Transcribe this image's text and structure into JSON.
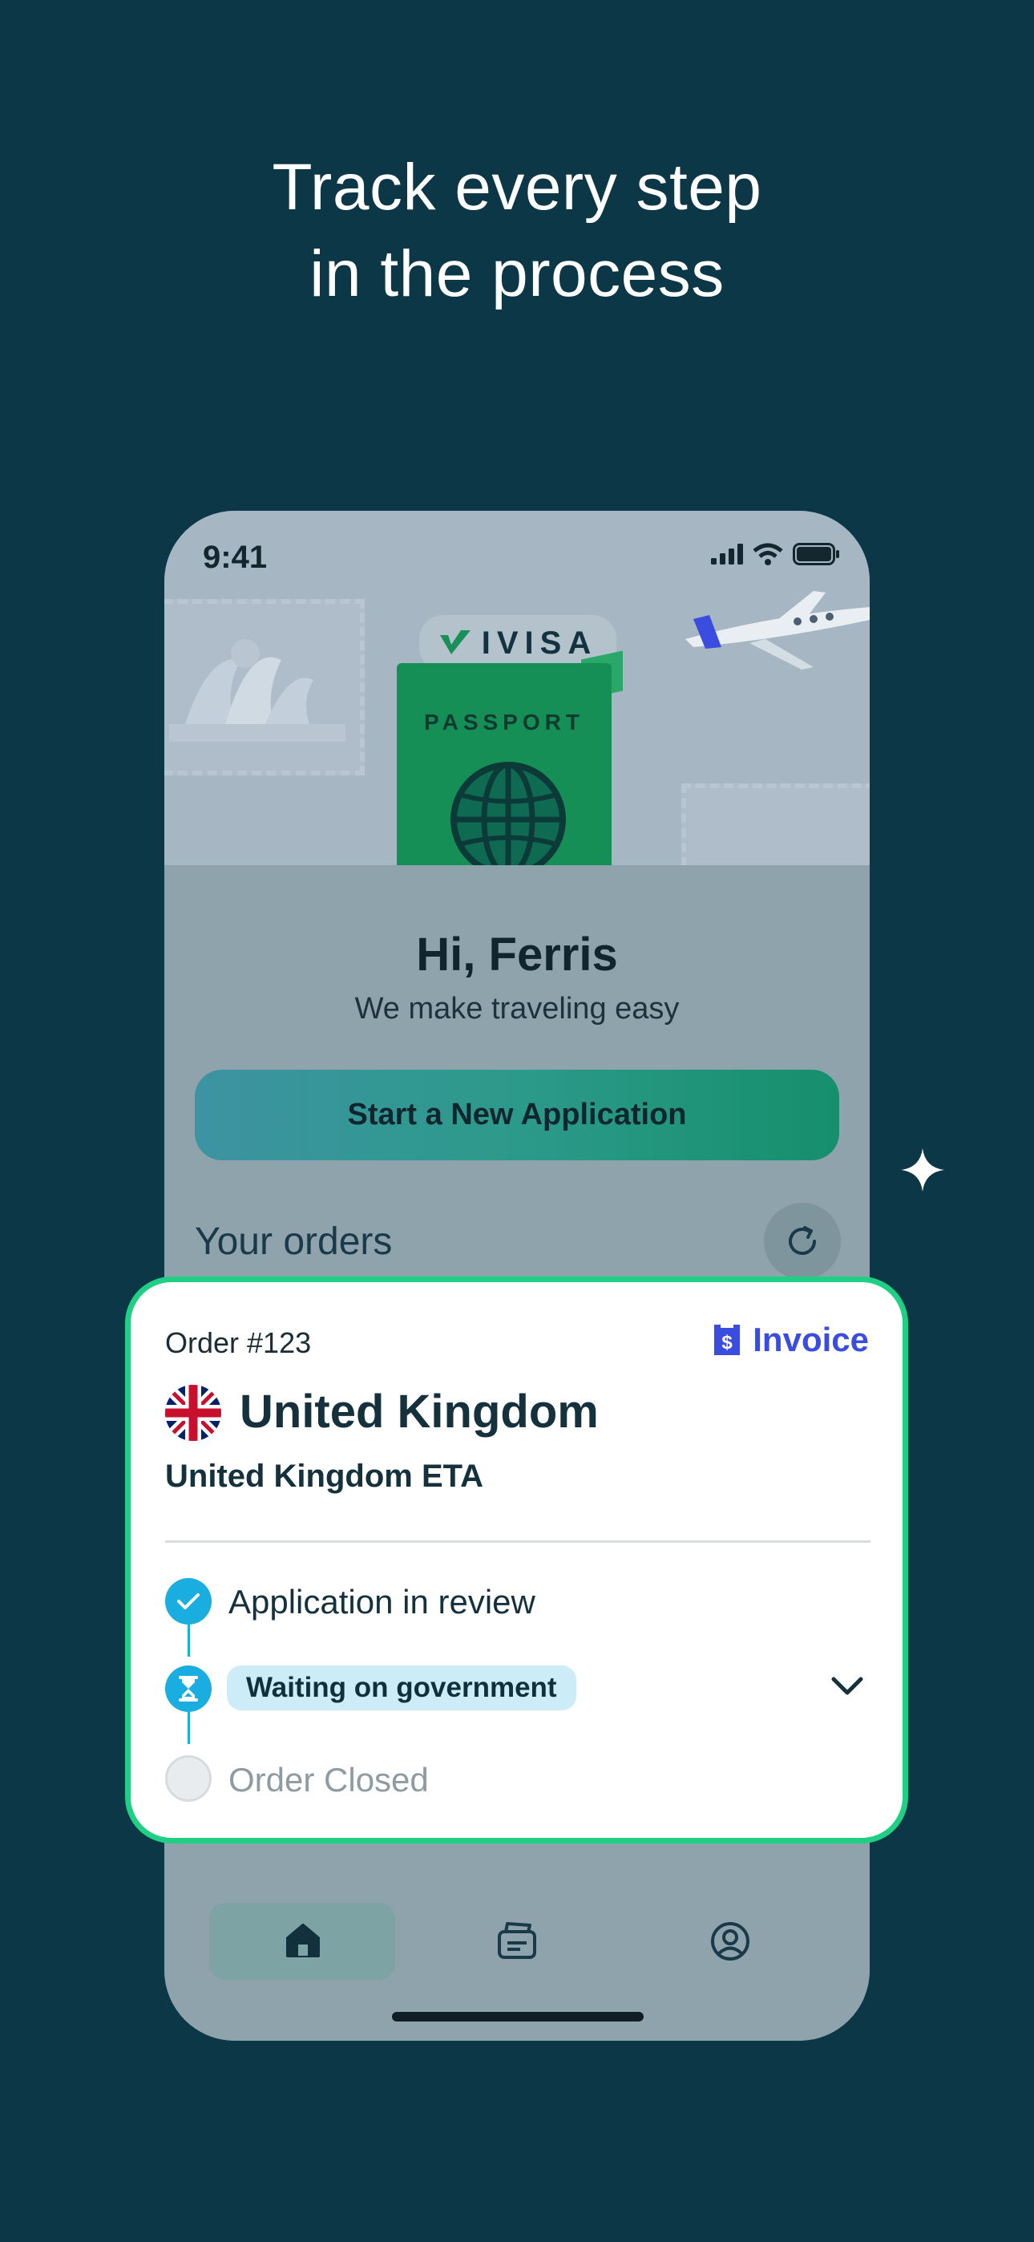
{
  "headline": {
    "line1": "Track every step",
    "line2": "in the process"
  },
  "phone": {
    "status_time": "9:41",
    "logo": "IVISA",
    "passport_label": "PASSPORT",
    "greeting": "Hi, Ferris",
    "tagline": "We make traveling easy",
    "start_button": "Start a New Application",
    "orders_title": "Your orders",
    "tabs": [
      "home-icon",
      "documents-icon",
      "profile-icon"
    ]
  },
  "order": {
    "number": "Order #123",
    "invoice_label": "Invoice",
    "country": "United Kingdom",
    "visa_type": "United Kingdom ETA",
    "steps": [
      {
        "label": "Application in review",
        "status": "done"
      },
      {
        "label": "Waiting on government",
        "status": "current"
      },
      {
        "label": "Order Closed",
        "status": "pending"
      }
    ]
  },
  "colors": {
    "background": "#0c3747",
    "card_border": "#1fcf84",
    "invoice": "#3a4de0",
    "step_active": "#1aaee0"
  }
}
